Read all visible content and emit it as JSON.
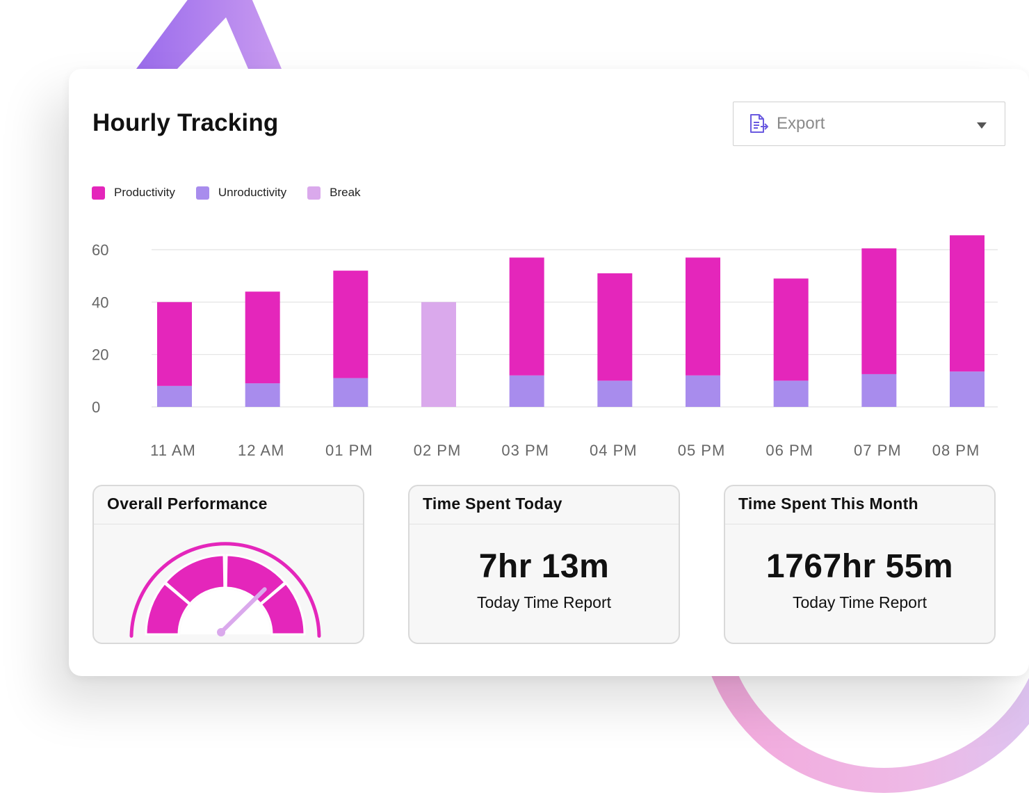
{
  "panel": {
    "title": "Hourly Tracking"
  },
  "export": {
    "label": "Export",
    "icon": "export-document-icon",
    "caret_icon": "caret-down-icon"
  },
  "colors": {
    "productivity": "#e426bb",
    "unproductivity": "#a88ced",
    "break": "#daa9ec",
    "gridline": "#e2e2e2",
    "axis_text": "#666666"
  },
  "legend": [
    {
      "label": "Productivity",
      "color": "#e426bb"
    },
    {
      "label": "Unroductivity",
      "color": "#a88ced"
    },
    {
      "label": "Break",
      "color": "#daa9ec"
    }
  ],
  "chart_data": {
    "type": "bar",
    "stacked": true,
    "title": "",
    "xlabel": "",
    "ylabel": "",
    "categories": [
      "11 AM",
      "12 AM",
      "01 PM",
      "02 PM",
      "03 PM",
      "04 PM",
      "05 PM",
      "06 PM",
      "07 PM",
      "08 PM"
    ],
    "y_ticks": [
      0,
      20,
      40,
      60
    ],
    "ylim": [
      0,
      60
    ],
    "grid": true,
    "legend_position": "top-left",
    "series": [
      {
        "name": "Unroductivity",
        "color": "#a88ced",
        "values": [
          8,
          9,
          11,
          0,
          12,
          10,
          12,
          10,
          12.5,
          13.5
        ]
      },
      {
        "name": "Productivity",
        "color": "#e426bb",
        "values": [
          32,
          35,
          41,
          0,
          45,
          41,
          45,
          39,
          48,
          52
        ]
      },
      {
        "name": "Break",
        "color": "#daa9ec",
        "values": [
          0,
          0,
          0,
          40,
          0,
          0,
          0,
          0,
          0,
          0
        ]
      }
    ]
  },
  "tiles": {
    "performance": {
      "title": "Overall Performance",
      "gauge_value": 0.84,
      "gauge_icon": "gauge-icon"
    },
    "today": {
      "title": "Time Spent Today",
      "value": "7hr 13m",
      "subtitle": "Today Time Report"
    },
    "month": {
      "title": "Time Spent This Month",
      "value": "1767hr 55m",
      "subtitle": "Today Time Report"
    }
  }
}
